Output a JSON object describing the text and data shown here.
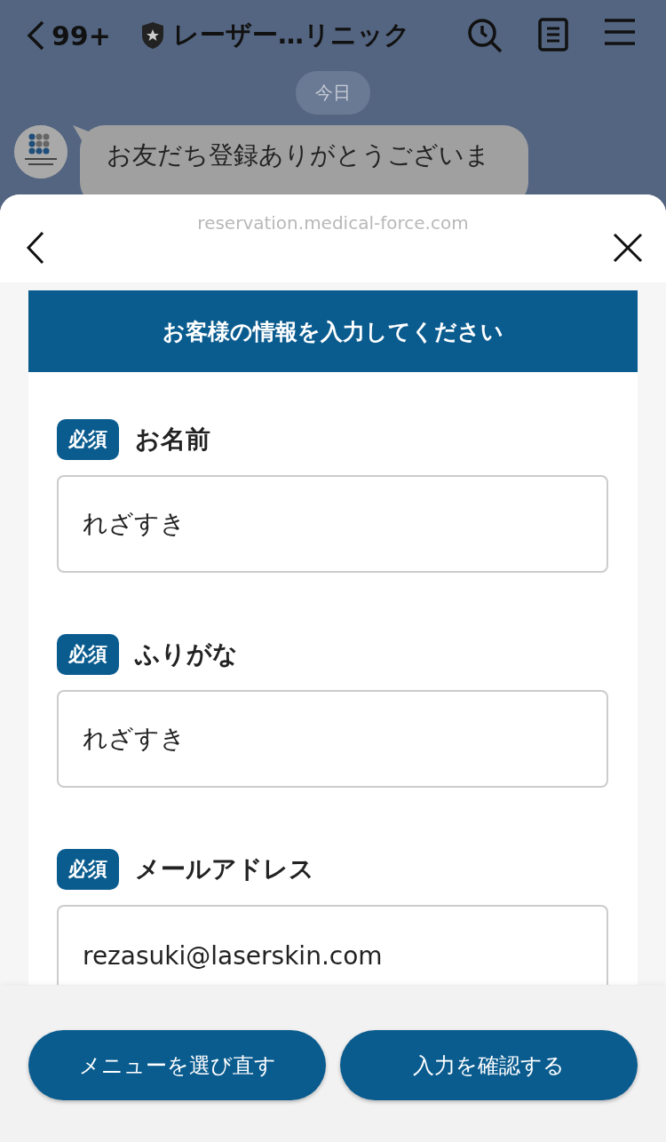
{
  "chat_header": {
    "unread_count": "99+",
    "title": "レーザー…リニック"
  },
  "date_divider": "今日",
  "message": {
    "text": "お友だち登録ありがとうございま"
  },
  "browser": {
    "url": "reservation.medical-force.com"
  },
  "form": {
    "heading": "お客様の情報を入力してください",
    "fields": [
      {
        "required": true,
        "required_label": "必須",
        "label": "お名前",
        "value": "れざすき"
      },
      {
        "required": true,
        "required_label": "必須",
        "label": "ふりがな",
        "value": "れざすき"
      },
      {
        "required": true,
        "required_label": "必須",
        "label": "メールアドレス",
        "value": "rezasuki@laserskin.com"
      }
    ]
  },
  "buttons": [
    {
      "label": "メニューを選び直す"
    },
    {
      "label": "入力を確認する"
    }
  ]
}
